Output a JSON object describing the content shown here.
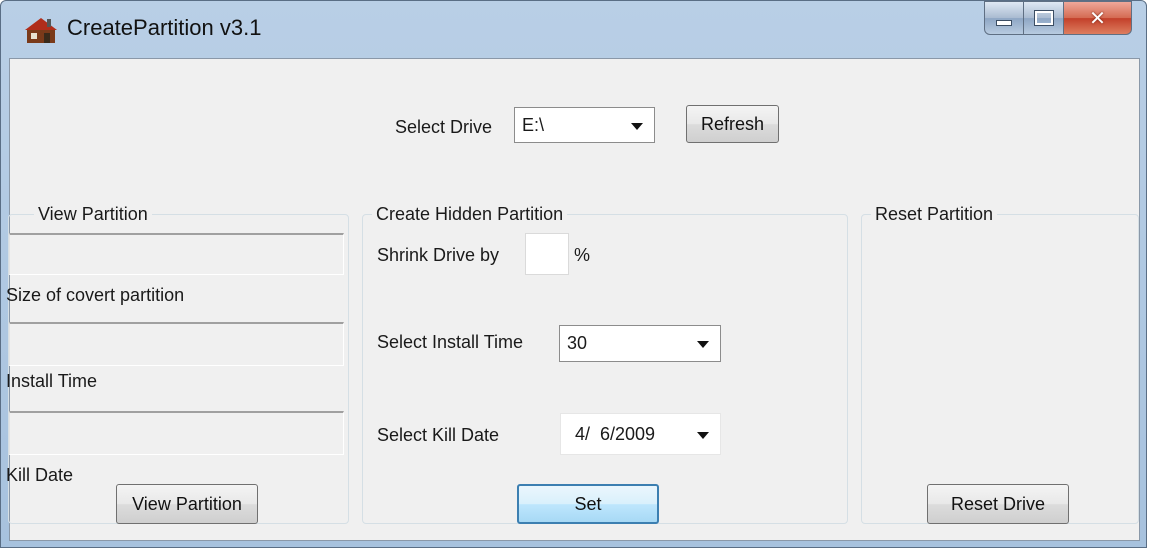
{
  "window": {
    "title": "CreatePartition v3.1"
  },
  "colors": {
    "titlebar": "#b9cfe6",
    "client": "#f0f0f0",
    "close_button": "#c3402a",
    "default_button_border": "#3c7fb1"
  },
  "icons": {
    "app": "app-icon",
    "minimize": "minimize-icon",
    "maximize": "maximize-icon",
    "close": "close-icon",
    "dropdown": "chevron-down-icon"
  },
  "drive": {
    "label": "Select Drive",
    "selected": "E:\\",
    "refresh_label": "Refresh"
  },
  "view_partition": {
    "legend": "View Partition",
    "size_label": "Size of covert partition",
    "install_time_label": "Install Time",
    "kill_date_label": "Kill Date",
    "button_label": "View Partition",
    "size_value": "",
    "install_time_value": "",
    "kill_date_value": ""
  },
  "create_hidden": {
    "legend": "Create Hidden Partition",
    "shrink_label": "Shrink Drive by",
    "shrink_value": "",
    "percent_sign": "%",
    "install_time_label": "Select Install Time",
    "install_time_selected": "30",
    "kill_date_label": "Select Kill Date",
    "kill_date_value": "4/  6/2009",
    "set_label": "Set"
  },
  "reset_partition": {
    "legend": "Reset Partition",
    "button_label": "Reset Drive"
  }
}
